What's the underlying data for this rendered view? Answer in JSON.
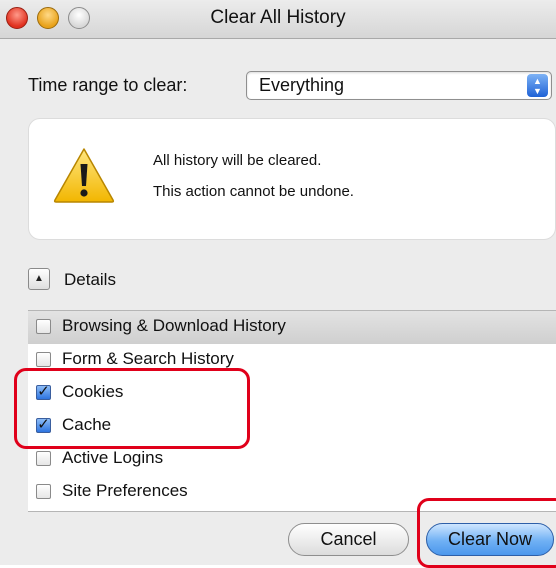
{
  "window": {
    "title": "Clear All History"
  },
  "time_range": {
    "label": "Time range to clear:",
    "selected": "Everything"
  },
  "warning": {
    "icon": "warning-icon",
    "line1": "All history will be cleared.",
    "line2": "This action cannot be undone."
  },
  "details": {
    "label": "Details",
    "toggle_icon": "triangle-up-icon"
  },
  "items": [
    {
      "label": "Browsing & Download History",
      "checked": false
    },
    {
      "label": "Form & Search History",
      "checked": false
    },
    {
      "label": "Cookies",
      "checked": true
    },
    {
      "label": "Cache",
      "checked": true
    },
    {
      "label": "Active Logins",
      "checked": false
    },
    {
      "label": "Site Preferences",
      "checked": false
    }
  ],
  "buttons": {
    "cancel": "Cancel",
    "clear_now": "Clear Now"
  },
  "colors": {
    "annotation": "#e0001a",
    "default_button": "#6fb0f4"
  }
}
